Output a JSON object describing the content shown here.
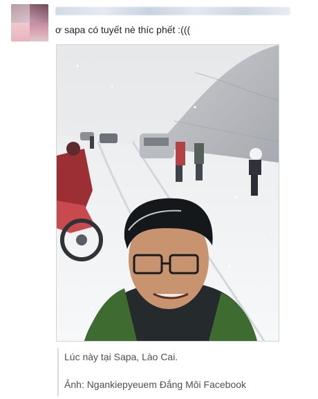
{
  "post": {
    "status_text": "ơ sapa có tuyết nè thíc phết :(((",
    "caption_location": "Lúc này tại Sapa, Lào Cai.",
    "caption_credit": "Ảnh: Ngankiepyeuem Đắng Môi Facebook"
  },
  "colors": {
    "text": "#1d2129",
    "caption_text": "#4b4f56",
    "caption_border": "#d6d9de"
  },
  "icons": {
    "avatar": "profile-photo",
    "photo": "snow-selfie-photo"
  }
}
